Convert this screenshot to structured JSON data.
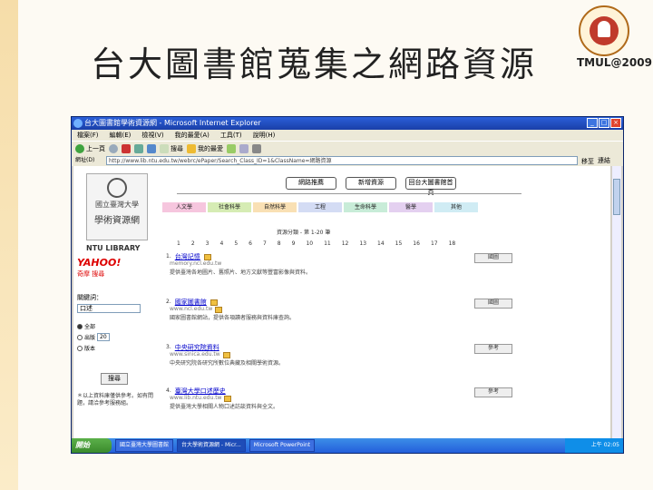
{
  "slide": {
    "title": "台大圖書館蒐集之網路資源",
    "tag": "TMUL@2009"
  },
  "browser": {
    "window_title": "台大圖書館學術資源網 - Microsoft Internet Explorer",
    "menu": [
      "檔案(F)",
      "編輯(E)",
      "檢視(V)",
      "我的最愛(A)",
      "工具(T)",
      "說明(H)"
    ],
    "toolbar": {
      "back": "上一頁",
      "search": "搜尋",
      "favorites": "我的最愛"
    },
    "address_label": "網址(D)",
    "address": "http://www.lib.ntu.edu.tw/webrc/ePaper/Search_Class_ID=1&ClassName=網路資源",
    "go_label": "移至",
    "links_label": "連結"
  },
  "sidebar": {
    "logo_line1": "國立臺灣大學",
    "logo_line2": "學術資源網",
    "library": "NTU LIBRARY",
    "yahoo": "YAHOO!",
    "yahoo_sub": "奇摩 搜尋",
    "search_label": "關鍵詞：",
    "search_value": "口述",
    "opt1": "全部",
    "opt2": "出版",
    "opt2_value": "20",
    "opt3": "版本",
    "search_button": "搜尋",
    "notes": "＊以上資料庫僅供參考。如有問題，請洽參考服務組。"
  },
  "main": {
    "top_buttons": [
      "網路推薦",
      "新增資源",
      "回台大圖書館首頁"
    ],
    "tabs": [
      "人文學",
      "社會科學",
      "自然科學",
      "工程",
      "生命科學",
      "醫學",
      "其他"
    ],
    "subtitle": "資源分類 - 第 1-20 筆",
    "pages": [
      "1",
      "2",
      "3",
      "4",
      "5",
      "6",
      "7",
      "8",
      "9",
      "10",
      "11",
      "12",
      "13",
      "14",
      "15",
      "16",
      "17",
      "18"
    ],
    "entries": [
      {
        "n": "1.",
        "title": "台灣記憶",
        "url": "memory.ncl.edu.tw",
        "btn": "國圖",
        "desc": "提供臺灣各地圖片、舊照片、地方文獻等豐富影像與資料。"
      },
      {
        "n": "2.",
        "title": "國家圖書館",
        "url": "www.ncl.edu.tw",
        "btn": "國圖",
        "desc": "國家圖書館網站，提供各項讀者服務與資料庫查詢。"
      },
      {
        "n": "3.",
        "title": "中央研究院資料",
        "url": "www.sinica.edu.tw",
        "btn": "參考",
        "desc": "中央研究院各研究所數位典藏及相關學術資源。"
      },
      {
        "n": "4.",
        "title": "臺灣大學口述歷史",
        "url": "www.lib.ntu.edu.tw",
        "btn": "參考",
        "desc": "提供臺灣大學相關人物口述訪談資料與全文。"
      }
    ]
  },
  "taskbar": {
    "start": "開始",
    "tasks": [
      "國立臺灣大學圖書館",
      "台大學術資源網 - Micr...",
      "Microsoft PowerPoint"
    ],
    "clock": "上午 02:05"
  }
}
